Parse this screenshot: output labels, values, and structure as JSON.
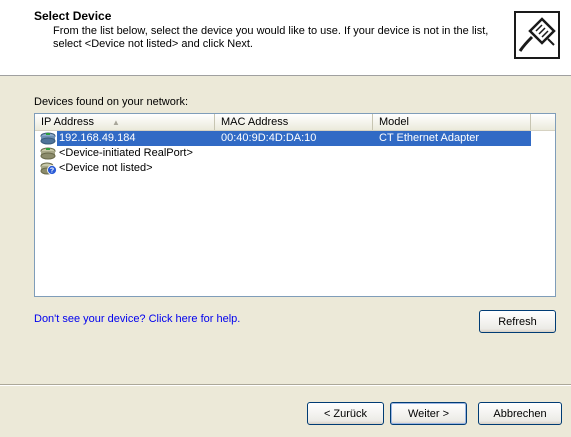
{
  "header": {
    "title": "Select Device",
    "description": "From the list below, select the device you would like to use. If your device is not in the list, select <Device not listed> and click Next.",
    "icon": "network-cable-icon"
  },
  "found_label": "Devices found on your network:",
  "table": {
    "columns": [
      "IP Address",
      "MAC Address",
      "Model"
    ],
    "sort_indicator": "ascending",
    "rows": [
      {
        "ip": "192.168.49.184",
        "mac": "00:40:9D:4D:DA:10",
        "model": "CT Ethernet Adapter",
        "icon": "network-device-icon",
        "selected": true
      },
      {
        "ip": "<Device-initiated RealPort>",
        "mac": "",
        "model": "",
        "icon": "network-device-icon",
        "selected": false
      },
      {
        "ip": "<Device not listed>",
        "mac": "",
        "model": "",
        "icon": "network-device-question-icon",
        "selected": false
      }
    ]
  },
  "help_link": "Don't see your device? Click here for help.",
  "buttons": {
    "refresh": "Refresh",
    "back": "< Zurück",
    "next": "Weiter >",
    "cancel": "Abbrechen"
  },
  "colors": {
    "selection": "#316ac5",
    "link": "#0000ee",
    "dialog_bg": "#ece9d8"
  }
}
